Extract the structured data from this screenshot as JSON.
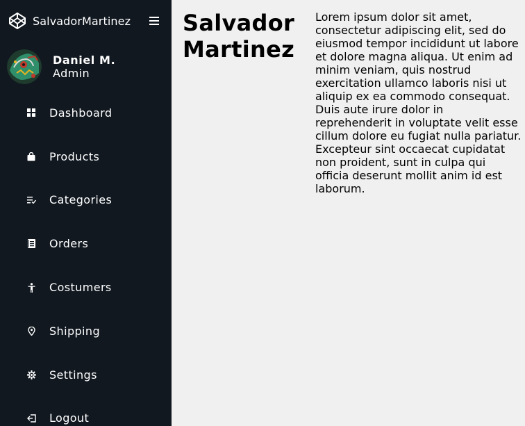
{
  "brand": {
    "name": "SalvadorMartinez",
    "logo_icon": "codepen-logo-icon",
    "menu_icon": "hamburger-menu-icon"
  },
  "profile": {
    "name": "Daniel M.",
    "role": "Admin",
    "avatar_icon": "avatar-image"
  },
  "nav": {
    "items": [
      {
        "label": "Dashboard",
        "icon": "dashboard-icon"
      },
      {
        "label": "Products",
        "icon": "shopping-bag-icon"
      },
      {
        "label": "Categories",
        "icon": "list-icon"
      },
      {
        "label": "Orders",
        "icon": "receipt-icon"
      },
      {
        "label": "Costumers",
        "icon": "person-icon"
      },
      {
        "label": "Shipping",
        "icon": "location-pin-icon"
      },
      {
        "label": "Settings",
        "icon": "gear-icon"
      },
      {
        "label": "Logout",
        "icon": "logout-icon"
      }
    ]
  },
  "main": {
    "title": "Salvador Martinez",
    "body": "Lorem ipsum dolor sit amet, consectetur adipiscing elit, sed do eiusmod tempor incididunt ut labore et dolore magna aliqua. Ut enim ad minim veniam, quis nostrud exercitation ullamco laboris nisi ut aliquip ex ea commodo consequat. Duis aute irure dolor in reprehenderit in voluptate velit esse cillum dolore eu fugiat nulla pariatur. Excepteur sint occaecat cupidatat non proident, sunt in culpa qui officia deserunt mollit anim id est laborum."
  },
  "colors": {
    "sidebar_bg": "#111820",
    "main_bg": "#f0f0f0",
    "sidebar_text": "#ffffff"
  }
}
